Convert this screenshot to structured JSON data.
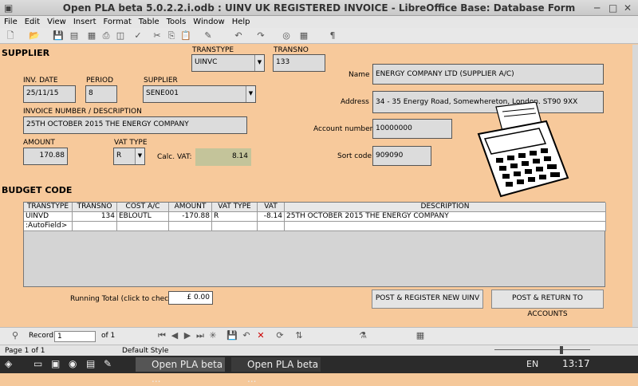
{
  "window": {
    "title": "Open PLA beta 5.0.2.2.i.odb : UINV  UK REGISTERED INVOICE - LibreOffice Base: Database Form"
  },
  "menu": [
    "File",
    "Edit",
    "View",
    "Insert",
    "Format",
    "Table",
    "Tools",
    "Window",
    "Help"
  ],
  "form": {
    "supplier_heading": "SUPPLIER",
    "transtype_label": "TRANSTYPE",
    "transtype": "UINVC",
    "transno_label": "TRANSNO",
    "transno": "133",
    "inv_date_label": "INV. DATE",
    "inv_date": "25/11/15",
    "period_label": "PERIOD",
    "period": "8",
    "supplier_label": "SUPPLIER",
    "supplier": "SENE001",
    "invoice_desc_label": "INVOICE NUMBER / DESCRIPTION",
    "invoice_desc": "25TH OCTOBER 2015  THE ENERGY COMPANY",
    "amount_label": "AMOUNT",
    "amount": "170.88",
    "vat_type_label": "VAT TYPE",
    "vat_type": "R",
    "calc_vat_label": "Calc. VAT:",
    "calc_vat": "8.14",
    "name_label": "Name",
    "name": "ENERGY COMPANY LTD (SUPPLIER A/C)",
    "address_label": "Address",
    "address": "34 - 35 Energy Road, Somewhereton, London. ST90 9XX",
    "account_label": "Account number",
    "account": "10000000",
    "sortcode_label": "Sort code",
    "sortcode": "909090",
    "budget_heading": "BUDGET CODE",
    "running_total_label": "Running Total (click to check)",
    "running_total": "£ 0.00",
    "btn_register": "POST & REGISTER NEW UINV",
    "btn_return": "POST & RETURN TO ACCOUNTS"
  },
  "grid": {
    "headers": [
      "TRANSTYPE",
      "TRANSNO",
      "COST A/C",
      "AMOUNT",
      "VAT TYPE",
      "VAT",
      "DESCRIPTION"
    ],
    "rows": [
      [
        "UINVD",
        "134",
        "EBLOUTL",
        "-170.88",
        "R",
        "-8.14",
        "25TH OCTOBER 2015  THE ENERGY COMPANY"
      ],
      [
        ":AutoField>",
        "",
        "",
        "",
        "",
        "",
        ""
      ]
    ]
  },
  "nav": {
    "record_label": "Record",
    "record": "1",
    "of_label": "of 1"
  },
  "status": {
    "page": "Page 1 of 1",
    "style": "Default Style"
  },
  "taskbar": {
    "task1": "Open PLA beta ...",
    "task2": "Open PLA beta ...",
    "lang": "EN",
    "clock": "13:17"
  }
}
